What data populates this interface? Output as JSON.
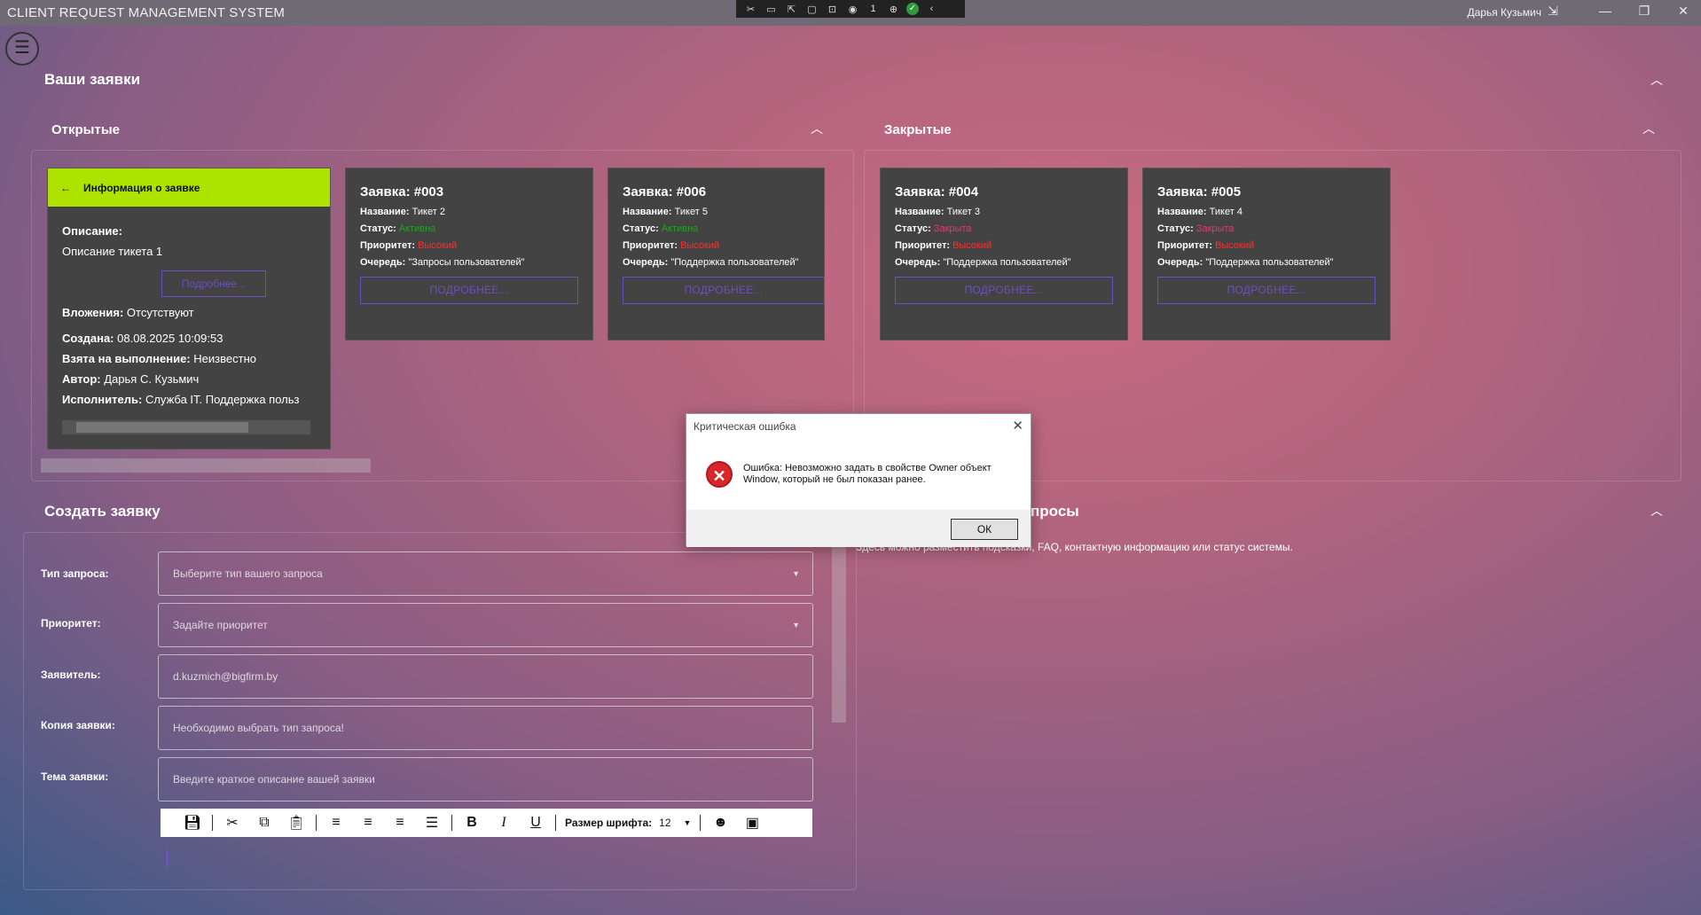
{
  "window": {
    "title": "CLIENT REQUEST MANAGEMENT SYSTEM",
    "user": "Дарья Кузьмич",
    "record_count": "1"
  },
  "sections": {
    "my_requests": "Ваши заявки",
    "open": "Открытые",
    "closed": "Закрытые",
    "create": "Создать заявку",
    "faq_partial": "просы",
    "faq_text": "Здесь можно разместить подсказки, FAQ, контактную информацию или статус системы."
  },
  "labels": {
    "name": "Название:",
    "status": "Статус:",
    "priority": "Приоритет:",
    "queue": "Очередь:",
    "more_btn": "ПОДРОБНЕЕ..."
  },
  "info_card": {
    "header": "Информация о заявке",
    "desc_label": "Описание:",
    "desc_value": "Описание тикета 1",
    "more_btn": "Подробнее...",
    "attach_label": "Вложения:",
    "attach_value": "Отсутствуют",
    "created_label": "Создана:",
    "created_value": "08.08.2025 10:09:53",
    "taken_label": "Взята на выполнение:",
    "taken_value": "Неизвестно",
    "author_label": "Автор:",
    "author_value": "Дарья С. Кузьмич",
    "executor_label": "Исполнитель:",
    "executor_value": "Служба IT. Поддержка польз"
  },
  "open_tickets": [
    {
      "title": "Заявка: #003",
      "name": "Тикет 2",
      "status": "Активна",
      "priority": "Высокий",
      "queue": "\"Запросы пользователей\""
    },
    {
      "title": "Заявка: #006",
      "name": "Тикет 5",
      "status": "Активна",
      "priority": "Высокий",
      "queue": "\"Поддержка пользователей\""
    }
  ],
  "closed_tickets": [
    {
      "title": "Заявка: #004",
      "name": "Тикет 3",
      "status": "Закрыта",
      "priority": "Высокий",
      "queue": "\"Поддержка пользователей\""
    },
    {
      "title": "Заявка: #005",
      "name": "Тикет 4",
      "status": "Закрыта",
      "priority": "Высокий",
      "queue": "\"Поддержка пользователей\""
    }
  ],
  "form": {
    "type_label": "Тип запроса:",
    "type_placeholder": "Выберите тип вашего запроса",
    "priority_label": "Приоритет:",
    "priority_placeholder": "Задайте приоритет",
    "applicant_label": "Заявитель:",
    "applicant_value": "d.kuzmich@bigfirm.by",
    "copy_label": "Копия заявки:",
    "copy_value": "Необходимо выбрать тип запроса!",
    "subject_label": "Тема заявки:",
    "subject_placeholder": "Введите краткое описание вашей заявки",
    "font_size_label": "Размер шрифта:",
    "font_size_value": "12"
  },
  "dialog": {
    "title": "Критическая ошибка",
    "message_line1": "Ошибка: Невозможно задать в свойстве Owner объект",
    "message_line2": "Window, который не был показан ранее.",
    "ok": "ОК"
  },
  "colors": {
    "accent_green": "#aee300",
    "active": "#21a321",
    "closed": "#e0396e",
    "high": "#ff2b2b",
    "button_purple": "#6a4fbf",
    "card_bg": "#434343"
  }
}
